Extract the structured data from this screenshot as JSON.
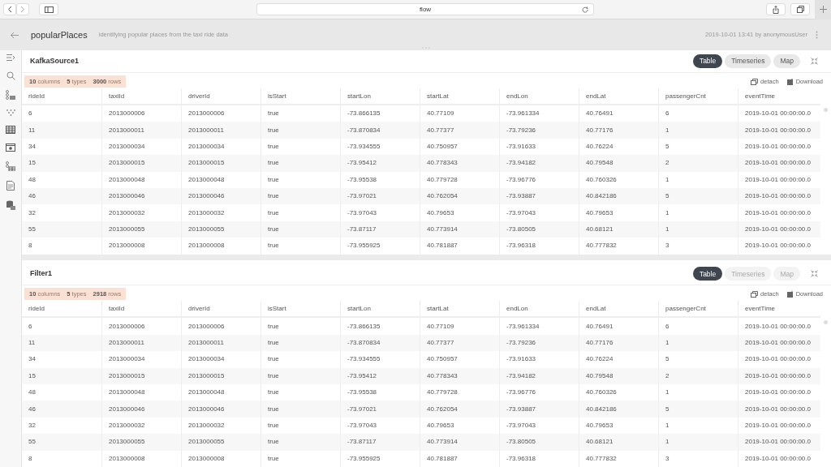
{
  "browser": {
    "address": "flow"
  },
  "header": {
    "title": "popularPlaces",
    "description": "identifying popular places from the taxi ride data",
    "meta": "2019-10-01 13:41 by anonymousUser"
  },
  "panels": [
    {
      "title": "KafkaSource1",
      "views": [
        {
          "label": "Table",
          "selected": true,
          "disabled": false
        },
        {
          "label": "Timeseries",
          "selected": false,
          "disabled": false
        },
        {
          "label": "Map",
          "selected": false,
          "disabled": false
        }
      ],
      "stats": [
        "**10** columns",
        "**5** types",
        "**3000** rows"
      ],
      "actions": [
        "detach",
        "Download"
      ],
      "columns": [
        "rideId",
        "taxiId",
        "driverId",
        "isStart",
        "startLon",
        "startLat",
        "endLon",
        "endLat",
        "passengerCnt",
        "eventTime"
      ],
      "rows": [
        [
          "6",
          "2013000006",
          "2013000006",
          "true",
          "-73.866135",
          "40.77109",
          "-73.961334",
          "40.76491",
          "6",
          "2019-10-01 00:00:00.0"
        ],
        [
          "11",
          "2013000011",
          "2013000011",
          "true",
          "-73.870834",
          "40.77377",
          "-73.79236",
          "40.77176",
          "1",
          "2019-10-01 00:00:00.0"
        ],
        [
          "34",
          "2013000034",
          "2013000034",
          "true",
          "-73.934555",
          "40.750957",
          "-73.91633",
          "40.76224",
          "5",
          "2019-10-01 00:00:00.0"
        ],
        [
          "15",
          "2013000015",
          "2013000015",
          "true",
          "-73.95412",
          "40.778343",
          "-73.94182",
          "40.79548",
          "2",
          "2019-10-01 00:00:00.0"
        ],
        [
          "48",
          "2013000048",
          "2013000048",
          "true",
          "-73.95538",
          "40.779728",
          "-73.96776",
          "40.760326",
          "1",
          "2019-10-01 00:00:00.0"
        ],
        [
          "46",
          "2013000046",
          "2013000046",
          "true",
          "-73.97021",
          "40.762054",
          "-73.93887",
          "40.842186",
          "5",
          "2019-10-01 00:00:00.0"
        ],
        [
          "32",
          "2013000032",
          "2013000032",
          "true",
          "-73.97043",
          "40.79653",
          "-73.97043",
          "40.79653",
          "1",
          "2019-10-01 00:00:00.0"
        ],
        [
          "55",
          "2013000055",
          "2013000055",
          "true",
          "-73.87117",
          "40.773914",
          "-73.80505",
          "40.68121",
          "1",
          "2019-10-01 00:00:00.0"
        ],
        [
          "8",
          "2013000008",
          "2013000008",
          "true",
          "-73.955925",
          "40.781887",
          "-73.96318",
          "40.777832",
          "3",
          "2019-10-01 00:00:00.0"
        ]
      ]
    },
    {
      "title": "Filter1",
      "views": [
        {
          "label": "Table",
          "selected": true,
          "disabled": false
        },
        {
          "label": "Timeseries",
          "selected": false,
          "disabled": true
        },
        {
          "label": "Map",
          "selected": false,
          "disabled": true
        }
      ],
      "stats": [
        "**10** columns",
        "**5** types",
        "**2918** rows"
      ],
      "actions": [
        "detach",
        "Download"
      ],
      "columns": [
        "rideId",
        "taxiId",
        "driverId",
        "isStart",
        "startLon",
        "startLat",
        "endLon",
        "endLat",
        "passengerCnt",
        "eventTime"
      ],
      "rows": [
        [
          "6",
          "2013000006",
          "2013000006",
          "true",
          "-73.866135",
          "40.77109",
          "-73.961334",
          "40.76491",
          "6",
          "2019-10-01 00:00:00.0"
        ],
        [
          "11",
          "2013000011",
          "2013000011",
          "true",
          "-73.870834",
          "40.77377",
          "-73.79236",
          "40.77176",
          "1",
          "2019-10-01 00:00:00.0"
        ],
        [
          "34",
          "2013000034",
          "2013000034",
          "true",
          "-73.934555",
          "40.750957",
          "-73.91633",
          "40.76224",
          "5",
          "2019-10-01 00:00:00.0"
        ],
        [
          "15",
          "2013000015",
          "2013000015",
          "true",
          "-73.95412",
          "40.778343",
          "-73.94182",
          "40.79548",
          "2",
          "2019-10-01 00:00:00.0"
        ],
        [
          "48",
          "2013000048",
          "2013000048",
          "true",
          "-73.95538",
          "40.779728",
          "-73.96776",
          "40.760326",
          "1",
          "2019-10-01 00:00:00.0"
        ],
        [
          "46",
          "2013000046",
          "2013000046",
          "true",
          "-73.97021",
          "40.762054",
          "-73.93887",
          "40.842186",
          "5",
          "2019-10-01 00:00:00.0"
        ],
        [
          "32",
          "2013000032",
          "2013000032",
          "true",
          "-73.97043",
          "40.79653",
          "-73.97043",
          "40.79653",
          "1",
          "2019-10-01 00:00:00.0"
        ],
        [
          "55",
          "2013000055",
          "2013000055",
          "true",
          "-73.87117",
          "40.773914",
          "-73.80505",
          "40.68121",
          "1",
          "2019-10-01 00:00:00.0"
        ],
        [
          "8",
          "2013000008",
          "2013000008",
          "true",
          "-73.955925",
          "40.781887",
          "-73.96318",
          "40.777832",
          "3",
          "2019-10-01 00:00:00.0"
        ]
      ]
    }
  ]
}
